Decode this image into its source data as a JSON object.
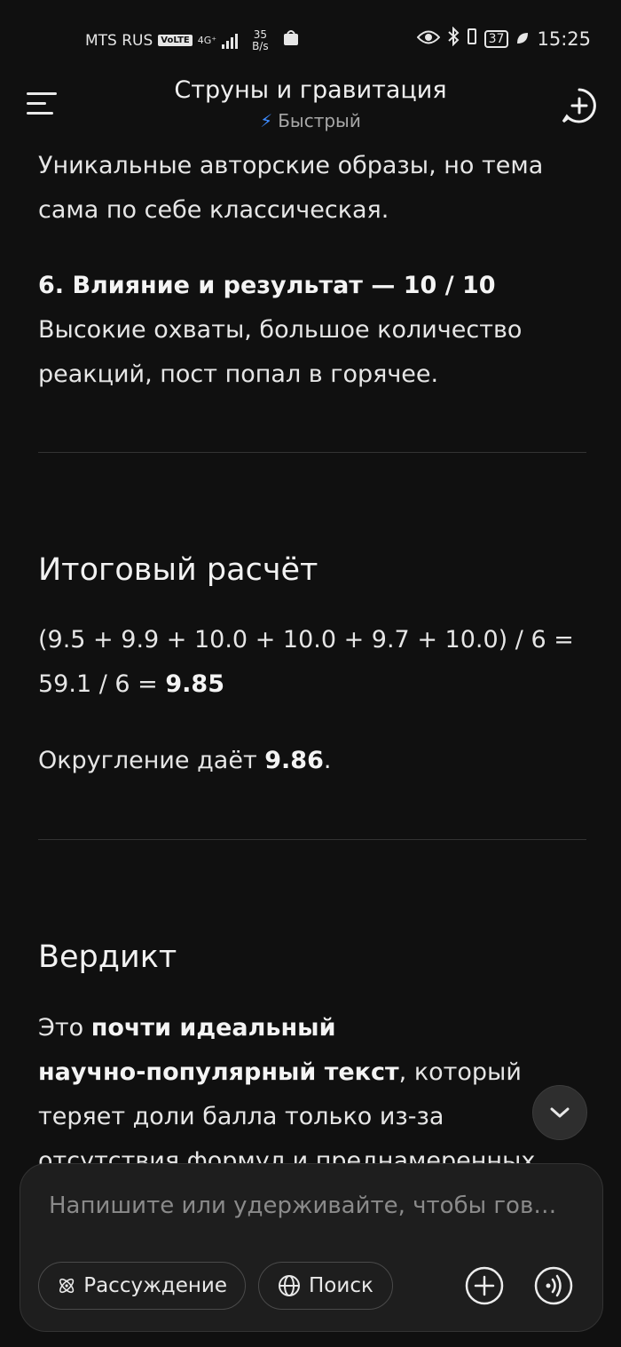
{
  "status_bar": {
    "carrier": "MTS RUS",
    "volte": "VoLTE",
    "network": "4G⁺",
    "speed_value": "35",
    "speed_unit": "B/s",
    "battery": "37",
    "time": "15:25"
  },
  "header": {
    "title": "Струны и гравитация",
    "mode": "Быстрый"
  },
  "content": {
    "intro_line1": "Уникальные авторские образы, но тема",
    "intro_line2": "сама по себе классическая.",
    "section6_title": "6. Влияние и результат — 10 / 10",
    "section6_line1": "Высокие охваты, большое количество",
    "section6_line2": "реакций, пост попал в горячее.",
    "total_heading": "Итоговый расчёт",
    "calc_line1": "(9.5 + 9.9 + 10.0 + 10.0 + 9.7 + 10.0) / 6 =",
    "calc_line2_prefix": "59.1 / 6 = ",
    "calc_result": "9.85",
    "rounding_prefix": "Округление даёт ",
    "rounding_value": "9.86",
    "rounding_suffix": ".",
    "verdict_heading": "Вердикт",
    "verdict_line1_prefix": "Это ",
    "verdict_line1_bold": "почти идеальный",
    "verdict_line2_bold": "научно-популярный текст",
    "verdict_line2_suffix": ", который",
    "verdict_line3": "теряет доли балла только из-за",
    "verdict_line4_partial": "отсутствия формул и преднамеренных"
  },
  "input": {
    "placeholder": "Напишите или удерживайте, чтобы гов…",
    "value": ""
  },
  "buttons": {
    "reasoning": "Рассуждение",
    "search": "Поиск"
  },
  "icons": {
    "menu": "menu-icon",
    "new_chat": "new-chat-icon",
    "bolt": "bolt-icon",
    "atom": "atom-icon",
    "globe": "globe-icon",
    "plus": "plus-icon",
    "voice": "voice-icon",
    "chevron": "chevron-down-icon"
  },
  "colors": {
    "background": "#101010",
    "accent": "#3d8bff"
  }
}
